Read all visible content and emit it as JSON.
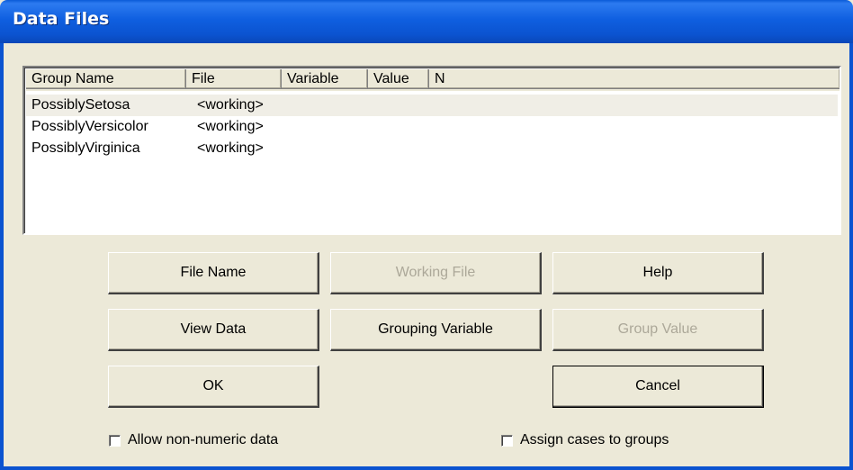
{
  "window": {
    "title": "Data Files",
    "title_color": "#0A5BD8",
    "face_color": "#ECE9D8"
  },
  "list": {
    "columns": [
      "Group Name",
      "File",
      "Variable",
      "Value",
      "N"
    ],
    "rows": [
      {
        "group": "PossiblySetosa",
        "file": "<working>",
        "selected": true
      },
      {
        "group": "PossiblyVersicolor",
        "file": "<working>",
        "selected": false
      },
      {
        "group": "PossiblyVirginica",
        "file": "<working>",
        "selected": false
      }
    ]
  },
  "buttons": {
    "file_name": "File Name",
    "working_file": "Working File",
    "help": "Help",
    "view_data": "View Data",
    "grouping_variable": "Grouping Variable",
    "group_value": "Group Value",
    "ok": "OK",
    "cancel": "Cancel"
  },
  "checkboxes": {
    "allow_non_numeric": {
      "label": "Allow non-numeric data",
      "checked": false
    },
    "assign_cases": {
      "label": "Assign cases to groups",
      "checked": false
    }
  }
}
